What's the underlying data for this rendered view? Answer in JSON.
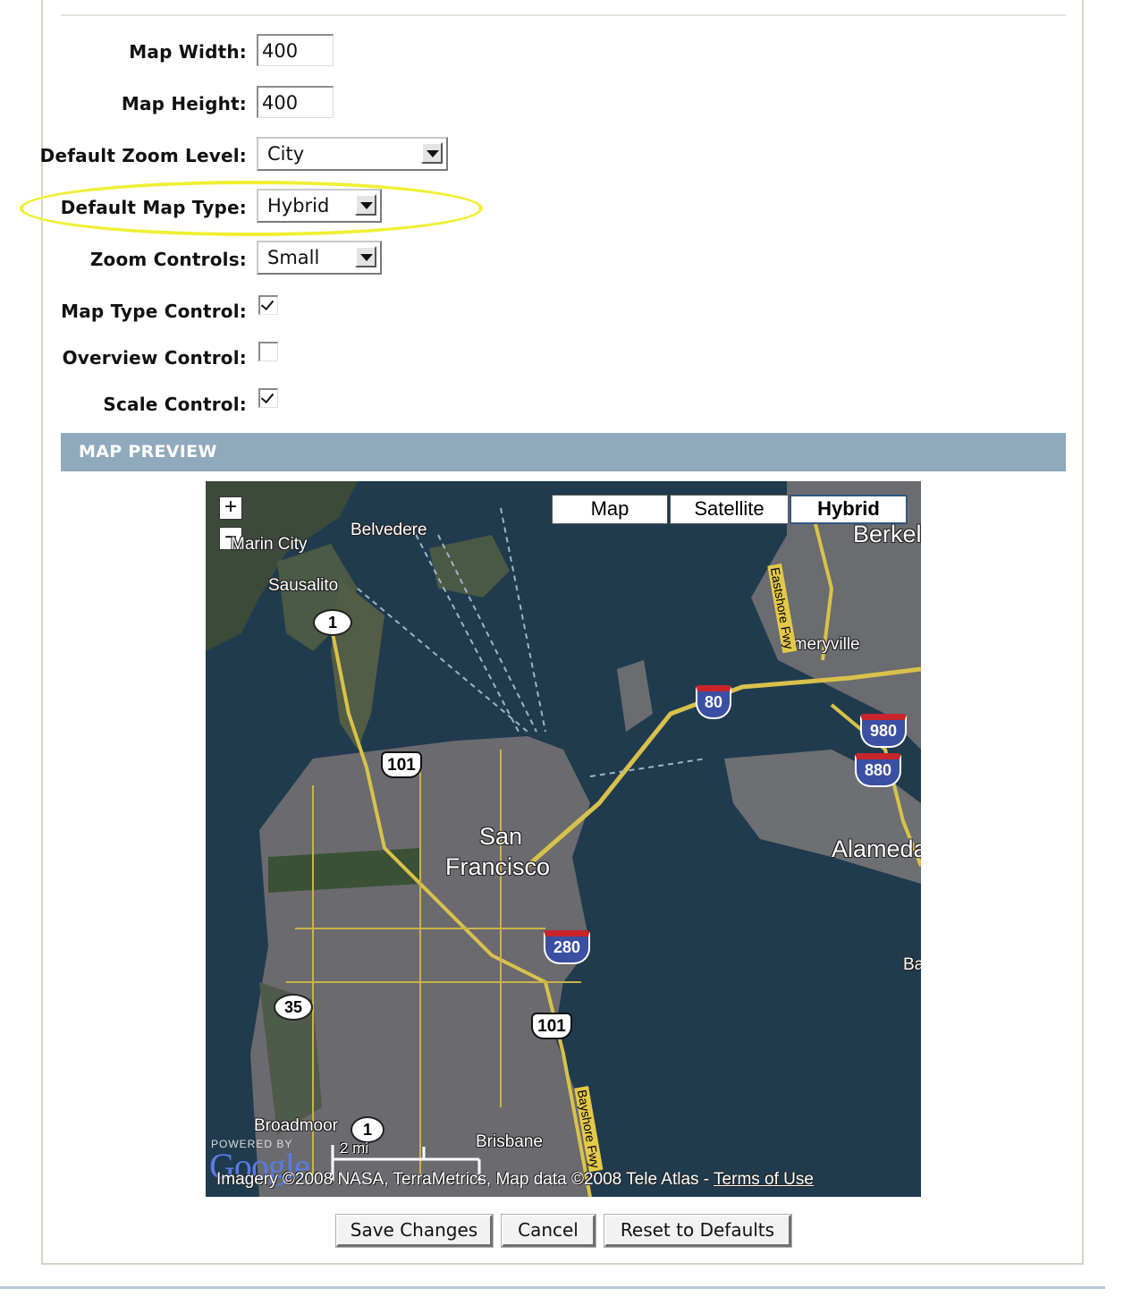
{
  "form": {
    "map_width": {
      "label": "Map Width:",
      "value": "400"
    },
    "map_height": {
      "label": "Map Height:",
      "value": "400"
    },
    "zoom_level": {
      "label": "Default Zoom Level:",
      "value": "City"
    },
    "map_type": {
      "label": "Default Map Type:",
      "value": "Hybrid"
    },
    "zoom_controls": {
      "label": "Zoom Controls:",
      "value": "Small"
    },
    "map_type_control": {
      "label": "Map Type Control:",
      "checked": true
    },
    "overview_control": {
      "label": "Overview Control:",
      "checked": false
    },
    "scale_control": {
      "label": "Scale Control:",
      "checked": true
    }
  },
  "section": {
    "title": "MAP PREVIEW"
  },
  "map": {
    "zoom_in": "+",
    "zoom_out": "−",
    "types": [
      "Map",
      "Satellite",
      "Hybrid"
    ],
    "active_type": "Hybrid",
    "places": {
      "marin_city": "Marin City",
      "belvedere": "Belvedere",
      "berkeley": "Berkel",
      "sausalito": "Sausalito",
      "emeryville": "Emeryville",
      "san": "San",
      "francisco": "Francisco",
      "alameda": "Alameda",
      "ba": "Ba",
      "broadmoor": "Broadmoor",
      "brisbane": "Brisbane",
      "eastshore": "Eastshore Fwy",
      "bayshore": "Bayshore Fwy"
    },
    "routes": {
      "r1a": "1",
      "r1b": "1",
      "r101a": "101",
      "r101b": "101",
      "r35": "35",
      "i80": "80",
      "i980": "980",
      "i880": "880",
      "i280": "280"
    },
    "powered_by": "POWERED BY",
    "logo": "Google",
    "scale": "2 mi",
    "attribution": "Imagery ©2008 NASA, TerraMetrics, Map data ©2008 Tele Atlas - ",
    "terms": "Terms of Use"
  },
  "buttons": {
    "save": "Save Changes",
    "cancel": "Cancel",
    "reset": "Reset to Defaults"
  },
  "colors": {
    "highlight": "#f0ef33",
    "section_bg": "#8fa9bd"
  }
}
